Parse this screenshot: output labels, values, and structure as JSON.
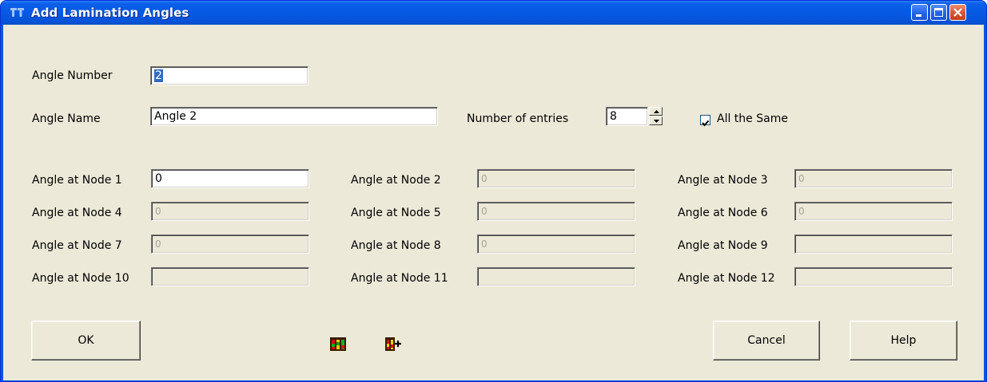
{
  "window": {
    "title": "Add Lamination Angles",
    "controls": [
      "minimize-icon",
      "maximize-icon",
      "close-icon"
    ]
  },
  "form": {
    "angle_number_label": "Angle Number",
    "angle_number_value": "2",
    "angle_name_label": "Angle Name",
    "angle_name_value": "Angle 2",
    "entries_label": "Number of entries",
    "entries_value": "8",
    "all_same_label": "All the Same",
    "all_same_checked": true
  },
  "nodes": [
    {
      "label": "Angle at Node 1",
      "value": "0",
      "enabled": true
    },
    {
      "label": "Angle at Node 2",
      "value": "0",
      "enabled": false
    },
    {
      "label": "Angle at Node 3",
      "value": "0",
      "enabled": false
    },
    {
      "label": "Angle at Node 4",
      "value": "0",
      "enabled": false
    },
    {
      "label": "Angle at Node 5",
      "value": "0",
      "enabled": false
    },
    {
      "label": "Angle at Node 6",
      "value": "0",
      "enabled": false
    },
    {
      "label": "Angle at Node 7",
      "value": "0",
      "enabled": false
    },
    {
      "label": "Angle at Node 8",
      "value": "0",
      "enabled": false
    },
    {
      "label": "Angle at Node 9",
      "value": "",
      "enabled": false
    },
    {
      "label": "Angle at Node 10",
      "value": "",
      "enabled": false
    },
    {
      "label": "Angle at Node 11",
      "value": "",
      "enabled": false
    },
    {
      "label": "Angle at Node 12",
      "value": "",
      "enabled": false
    }
  ],
  "buttons": {
    "ok": "OK",
    "cancel": "Cancel",
    "help": "Help"
  },
  "toolbar_icons": [
    "color-bars-icon",
    "color-bars-add-icon"
  ],
  "colors": {
    "titlebar": "#0758e3",
    "dialog_bg": "#ece9d8",
    "selection": "#316ac5"
  }
}
